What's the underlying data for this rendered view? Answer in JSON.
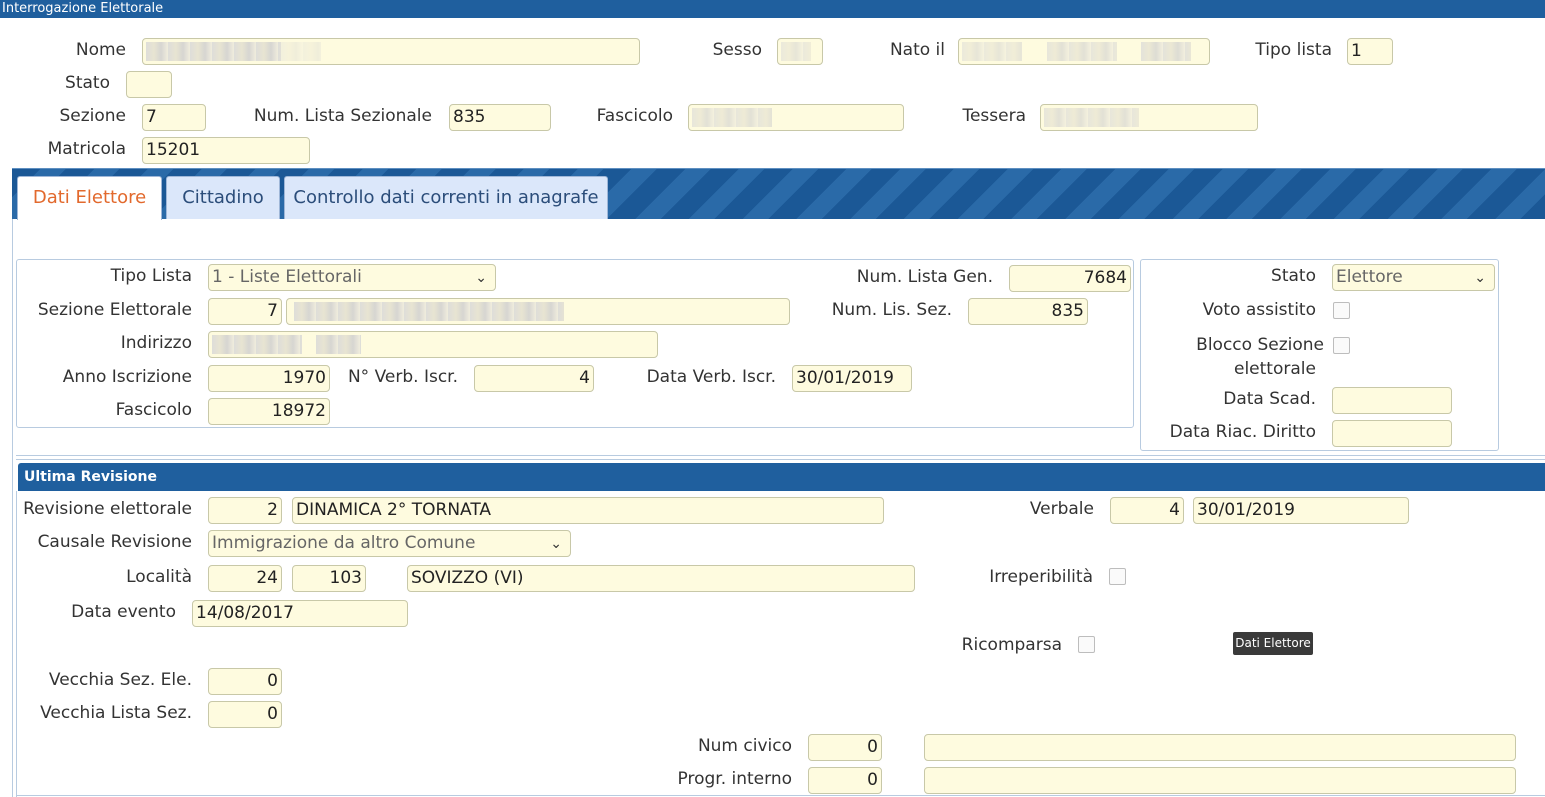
{
  "window": {
    "title": "Interrogazione Elettorale"
  },
  "header": {
    "nome_label": "Nome",
    "sesso_label": "Sesso",
    "nato_il_label": "Nato il",
    "tipo_lista_label": "Tipo lista",
    "tipo_lista_value": "1",
    "stato_label": "Stato",
    "stato_value": "",
    "sezione_label": "Sezione",
    "sezione_value": "7",
    "num_lista_sezionale_label": "Num. Lista Sezionale",
    "num_lista_sezionale_value": "835",
    "fascicolo_label": "Fascicolo",
    "tessera_label": "Tessera",
    "matricola_label": "Matricola",
    "matricola_value": "15201"
  },
  "tabs": [
    {
      "label": "Dati Elettore",
      "active": true
    },
    {
      "label": "Cittadino",
      "active": false
    },
    {
      "label": "Controllo dati correnti in anagrafe",
      "active": false
    }
  ],
  "dati_elettore": {
    "tipo_lista_label": "Tipo Lista",
    "tipo_lista_value": "1 - Liste Elettorali",
    "num_lista_gen_label": "Num. Lista Gen.",
    "num_lista_gen_value": "7684",
    "sezione_elettorale_label": "Sezione Elettorale",
    "sezione_elettorale_value": "7",
    "num_lis_sez_label": "Num. Lis. Sez.",
    "num_lis_sez_value": "835",
    "indirizzo_label": "Indirizzo",
    "anno_iscrizione_label": "Anno Iscrizione",
    "anno_iscrizione_value": "1970",
    "n_verb_iscr_label": "N° Verb. Iscr.",
    "n_verb_iscr_value": "4",
    "data_verb_iscr_label": "Data Verb. Iscr.",
    "data_verb_iscr_value": "30/01/2019",
    "fascicolo_label": "Fascicolo",
    "fascicolo_value": "18972"
  },
  "stato_panel": {
    "stato_label": "Stato",
    "stato_value": "Elettore",
    "voto_assistito_label": "Voto assistito",
    "blocco_sezione_label_1": "Blocco Sezione",
    "blocco_sezione_label_2": "elettorale",
    "data_scad_label": "Data Scad.",
    "data_scad_value": "",
    "data_riac_label": "Data Riac. Diritto",
    "data_riac_value": ""
  },
  "ultima_revisione": {
    "title": "Ultima Revisione",
    "revisione_label": "Revisione elettorale",
    "revisione_num": "2",
    "revisione_desc": "DINAMICA 2° TORNATA",
    "verbale_label": "Verbale",
    "verbale_num": "4",
    "verbale_data": "30/01/2019",
    "causale_label": "Causale Revisione",
    "causale_value": "Immigrazione da altro Comune",
    "localita_label": "Località",
    "localita_code1": "24",
    "localita_code2": "103",
    "localita_name": "SOVIZZO (VI)",
    "irreperibilita_label": "Irreperibilità",
    "data_evento_label": "Data evento",
    "data_evento_value": "14/08/2017",
    "ricomparsa_label": "Ricomparsa",
    "tooltip": "Dati Elettore",
    "vecchia_sez_label": "Vecchia Sez. Ele.",
    "vecchia_sez_value": "0",
    "vecchia_lista_label": "Vecchia Lista Sez.",
    "vecchia_lista_value": "0",
    "num_civico_label": "Num civico",
    "num_civico_value": "0",
    "progr_interno_label": "Progr. interno",
    "progr_interno_value": "0"
  }
}
